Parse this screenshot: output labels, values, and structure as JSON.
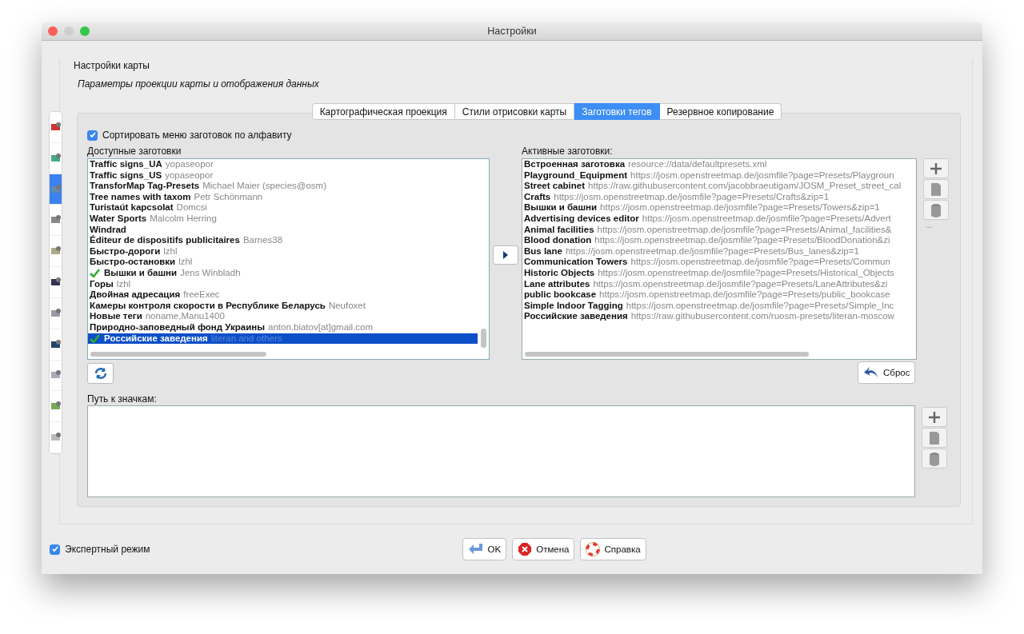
{
  "window": {
    "title": "Настройки"
  },
  "header": {
    "title": "Настройки карты",
    "subtitle": "Параметры проекции карты и отображения данных"
  },
  "sidebar": {
    "items": [
      {
        "selected": false
      },
      {
        "selected": false
      },
      {
        "selected": true
      },
      {
        "selected": false
      },
      {
        "selected": false
      },
      {
        "selected": false
      },
      {
        "selected": false
      },
      {
        "selected": false
      },
      {
        "selected": false
      },
      {
        "selected": false
      },
      {
        "selected": false
      }
    ]
  },
  "tabs": [
    {
      "label": "Картографическая проекция",
      "selected": false
    },
    {
      "label": "Стили отрисовки карты",
      "selected": false
    },
    {
      "label": "Заготовки тегов",
      "selected": true
    },
    {
      "label": "Резервное копирование",
      "selected": false
    }
  ],
  "sort_option": {
    "label": "Сортировать меню заготовок по алфавиту",
    "checked": true
  },
  "available": {
    "label": "Доступные заготовки",
    "items": [
      {
        "name": "Traffic signs_UA",
        "author": "yopaseopor",
        "active": false,
        "selected": false
      },
      {
        "name": "Traffic signs_US",
        "author": "yopaseopor",
        "active": false,
        "selected": false
      },
      {
        "name": "TransforMap Tag-Presets",
        "author": "Michael Maier (species@osm)",
        "active": false,
        "selected": false
      },
      {
        "name": "Tree names with taxom",
        "author": "Petr Schönmann",
        "active": false,
        "selected": false
      },
      {
        "name": "Turistaút kapcsolat",
        "author": "Domcsi",
        "active": false,
        "selected": false
      },
      {
        "name": "Water Sports",
        "author": "Malcolm Herring",
        "active": false,
        "selected": false
      },
      {
        "name": "Windrad",
        "active": false,
        "selected": false
      },
      {
        "name": "Éditeur de dispositifs publicitaires",
        "author": "Barnes38",
        "active": false,
        "selected": false
      },
      {
        "name": "Быстро-дороги",
        "author": "lzhl",
        "active": false,
        "selected": false
      },
      {
        "name": "Быстро-остановки",
        "author": "lzhl",
        "active": false,
        "selected": false
      },
      {
        "name": "Вышки и башни",
        "author": "Jens Winbladh",
        "active": true,
        "selected": false
      },
      {
        "name": "Горы",
        "author": "lzhl",
        "active": false,
        "selected": false
      },
      {
        "name": "Двойная адресация",
        "author": "freeExec",
        "active": false,
        "selected": false
      },
      {
        "name": "Камеры контроля скорости в Республике Беларусь",
        "author": "Neufoxet",
        "active": false,
        "selected": false
      },
      {
        "name": "Новые теги",
        "author": "noname,Manu1400",
        "active": false,
        "selected": false
      },
      {
        "name": "Природно-заповедный фонд Украины",
        "author": "anton.biatov[at]gmail.com",
        "active": false,
        "selected": false
      },
      {
        "name": "Российские заведения",
        "author": "literan and others",
        "active": true,
        "selected": true
      }
    ]
  },
  "active": {
    "label": "Активные заготовки:",
    "items": [
      {
        "name": "Встроенная заготовка",
        "source": "resource://data/defaultpresets.xml"
      },
      {
        "name": "Playground_Equipment",
        "source": "https://josm.openstreetmap.de/josmfile?page=Presets/Playgroun"
      },
      {
        "name": "Street cabinet",
        "source": "https://raw.githubusercontent.com/jacobbraeutigam/JOSM_Preset_street_cal"
      },
      {
        "name": "Crafts",
        "source": "https://josm.openstreetmap.de/josmfile?page=Presets/Crafts&zip=1"
      },
      {
        "name": "Вышки и башни",
        "source": "https://josm.openstreetmap.de/josmfile?page=Presets/Towers&zip=1"
      },
      {
        "name": "Advertising devices editor",
        "source": "https://josm.openstreetmap.de/josmfile?page=Presets/Advert"
      },
      {
        "name": "Animal facilities",
        "source": "https://josm.openstreetmap.de/josmfile?page=Presets/Animal_facilities&"
      },
      {
        "name": "Blood donation",
        "source": "https://josm.openstreetmap.de/josmfile?page=Presets/BloodDonation&zi"
      },
      {
        "name": "Bus lane",
        "source": "https://josm.openstreetmap.de/josmfile?page=Presets/Bus_lanes&zip=1"
      },
      {
        "name": "Communication Towers",
        "source": "https://josm.openstreetmap.de/josmfile?page=Presets/Commun"
      },
      {
        "name": "Historic Objects",
        "source": "https://josm.openstreetmap.de/josmfile?page=Presets/Historical_Objects"
      },
      {
        "name": "Lane attributes",
        "source": "https://josm.openstreetmap.de/josmfile?page=Presets/LaneAttributes&zi"
      },
      {
        "name": "public bookcase",
        "source": "https://josm.openstreetmap.de/josmfile?page=Presets/public_bookcase"
      },
      {
        "name": "Simple Indoor Tagging",
        "source": "https://josm.openstreetmap.de/josmfile?page=Presets/Simple_Inc"
      },
      {
        "name": "Российские заведения",
        "source": "https://raw.githubusercontent.com/ruosm-presets/literan-moscow"
      }
    ],
    "more": "..."
  },
  "reset_button": "Сброс",
  "icon_path": {
    "label": "Путь к значкам:"
  },
  "expert_mode": {
    "label": "Экспертный режим",
    "checked": true
  },
  "buttons": [
    {
      "kind": "ok",
      "label": "OK"
    },
    {
      "kind": "cancel",
      "label": "Отмена"
    },
    {
      "kind": "help",
      "label": "Справка"
    }
  ]
}
